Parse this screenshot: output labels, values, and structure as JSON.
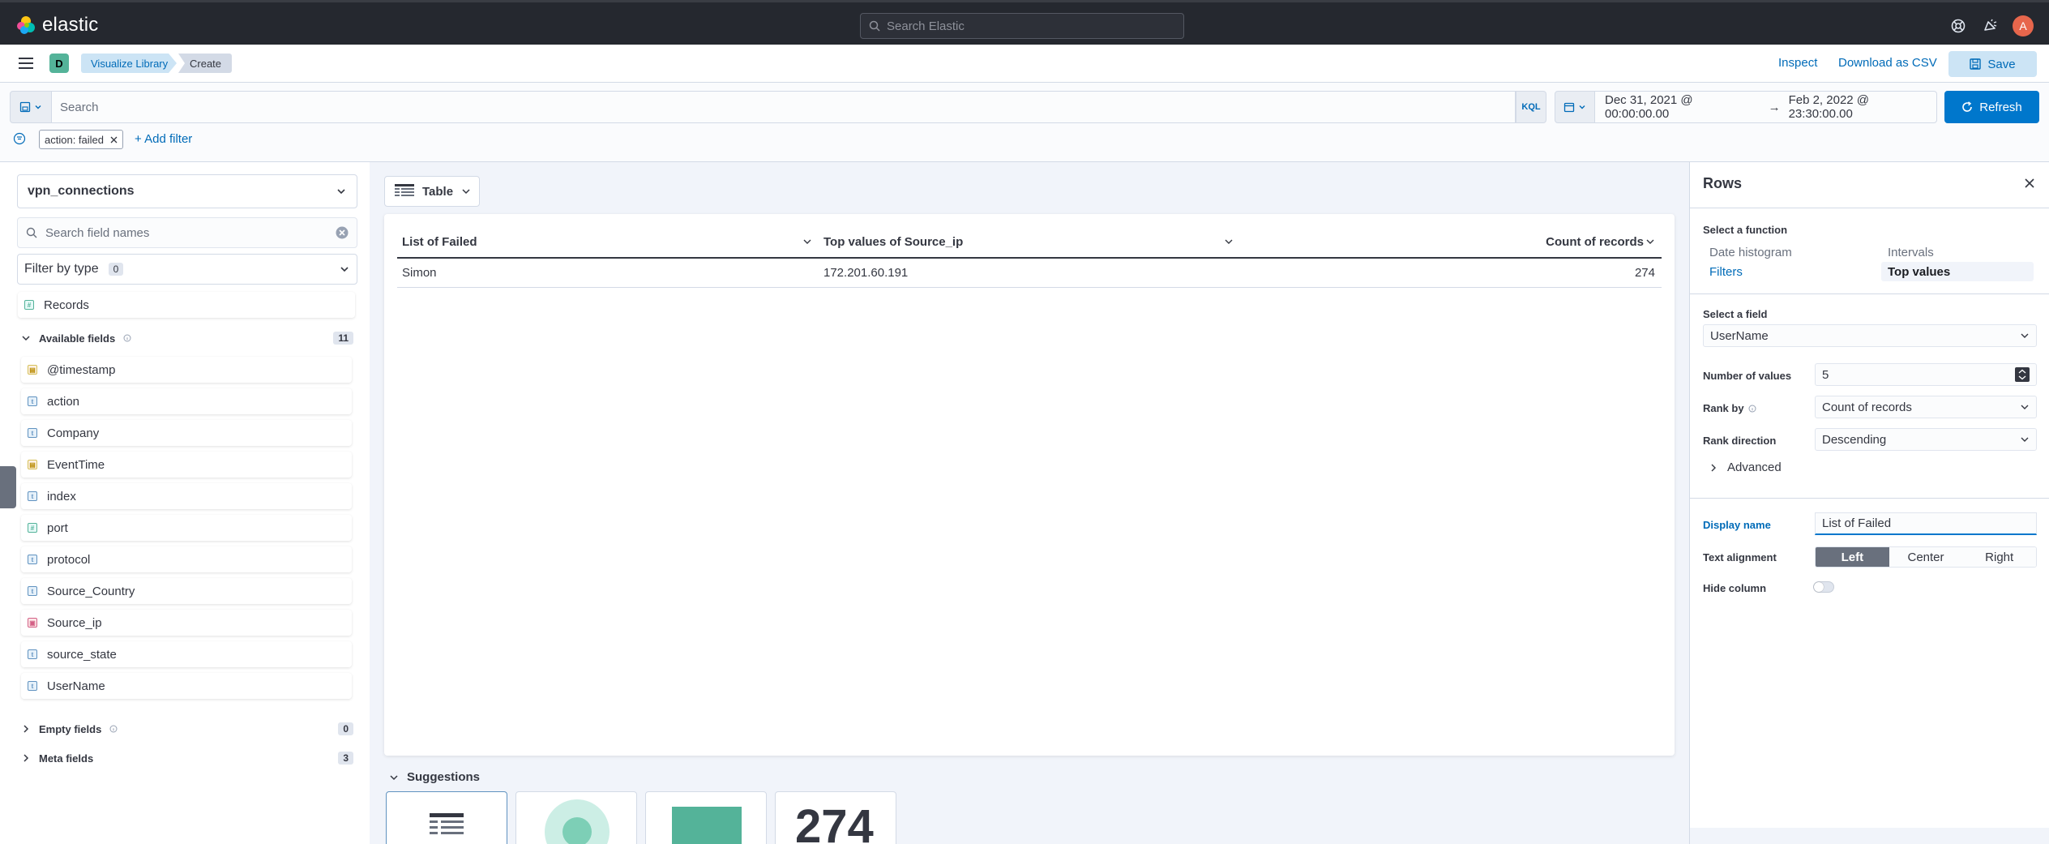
{
  "app": {
    "brand": "elastic",
    "space_initial": "D",
    "user_initial": "A"
  },
  "global_search": {
    "placeholder": "Search Elastic"
  },
  "breadcrumbs": [
    "Visualize Library",
    "Create"
  ],
  "header_actions": {
    "inspect": "Inspect",
    "download": "Download as CSV",
    "save": "Save"
  },
  "query_bar": {
    "placeholder": "Search",
    "language": "KQL",
    "date_start": "Dec 31, 2021 @ 00:00:00.00",
    "date_arrow": "→",
    "date_end": "Feb 2, 2022 @ 23:30:00.00",
    "refresh": "Refresh"
  },
  "filters": {
    "active": [
      "action: failed"
    ],
    "add_label": "+ Add filter"
  },
  "sidebar": {
    "index_pattern": "vpn_connections",
    "search_placeholder": "Search field names",
    "filter_by_type": "Filter by type",
    "filter_count": "0",
    "records": "Records",
    "available_label": "Available fields",
    "available_count": "11",
    "fields": [
      {
        "name": "@timestamp",
        "type": "date"
      },
      {
        "name": "action",
        "type": "str"
      },
      {
        "name": "Company",
        "type": "str"
      },
      {
        "name": "EventTime",
        "type": "date"
      },
      {
        "name": "index",
        "type": "str"
      },
      {
        "name": "port",
        "type": "num"
      },
      {
        "name": "protocol",
        "type": "str"
      },
      {
        "name": "Source_Country",
        "type": "str"
      },
      {
        "name": "Source_ip",
        "type": "ip"
      },
      {
        "name": "source_state",
        "type": "str"
      },
      {
        "name": "UserName",
        "type": "str"
      }
    ],
    "empty_label": "Empty fields",
    "empty_count": "0",
    "meta_label": "Meta fields",
    "meta_count": "3"
  },
  "workspace": {
    "chart_type": "Table",
    "table": {
      "columns": [
        "List of Failed",
        "Top values of Source_ip",
        "Count of records"
      ],
      "rows": [
        [
          "Simon",
          "172.201.60.191",
          "274"
        ]
      ]
    },
    "suggestions_label": "Suggestions",
    "suggestion_metric": "274"
  },
  "dimension_panel": {
    "title": "Rows",
    "select_function_label": "Select a function",
    "functions": [
      "Date histogram",
      "Intervals",
      "Filters",
      "Top values"
    ],
    "selected_function": "Top values",
    "select_field_label": "Select a field",
    "field": "UserName",
    "num_values_label": "Number of values",
    "num_values": "5",
    "rank_by_label": "Rank by",
    "rank_by": "Count of records",
    "rank_direction_label": "Rank direction",
    "rank_direction": "Descending",
    "advanced_label": "Advanced",
    "display_name_label": "Display name",
    "display_name": "List of Failed",
    "text_alignment_label": "Text alignment",
    "alignments": [
      "Left",
      "Center",
      "Right"
    ],
    "selected_alignment": "Left",
    "hide_column_label": "Hide column",
    "hide_column": false
  },
  "colors": {
    "accent": "#0077cc",
    "header_bg": "#25282f",
    "space_badge": "#54b399",
    "avatar": "#e7664c"
  }
}
